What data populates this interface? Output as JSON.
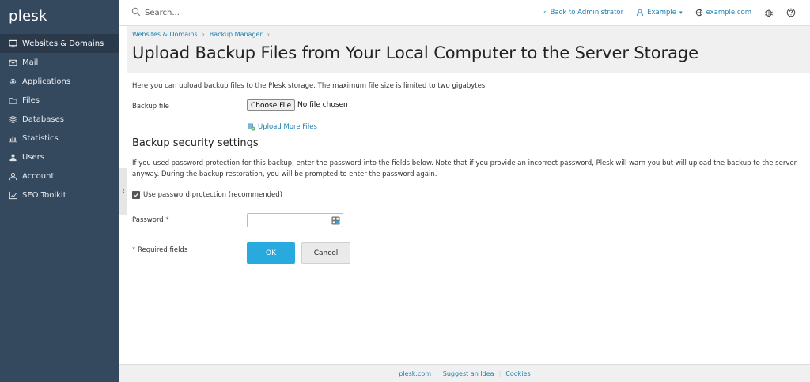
{
  "app": {
    "logo": "plesk"
  },
  "sidebar": {
    "items": [
      {
        "label": "Websites & Domains",
        "icon": "monitor-icon",
        "active": true
      },
      {
        "label": "Mail",
        "icon": "mail-icon"
      },
      {
        "label": "Applications",
        "icon": "gear-icon"
      },
      {
        "label": "Files",
        "icon": "folder-icon"
      },
      {
        "label": "Databases",
        "icon": "database-icon"
      },
      {
        "label": "Statistics",
        "icon": "bar-chart-icon"
      },
      {
        "label": "Users",
        "icon": "user-icon"
      },
      {
        "label": "Account",
        "icon": "account-icon"
      },
      {
        "label": "SEO Toolkit",
        "icon": "seo-chart-icon"
      }
    ],
    "collapse_glyph": "‹"
  },
  "header": {
    "search_placeholder": "Search...",
    "back_link": "Back to Administrator",
    "user": "Example",
    "domain": "example.com"
  },
  "breadcrumb": [
    "Websites & Domains",
    "Backup Manager"
  ],
  "page": {
    "title": "Upload Backup Files from Your Local Computer to the Server Storage",
    "intro": "Here you can upload backup files to the Plesk storage. The maximum file size is limited to two gigabytes.",
    "backup_file_label": "Backup file",
    "choose_file": "Choose File",
    "no_file": "No file chosen",
    "upload_more": "Upload More Files",
    "security_title": "Backup security settings",
    "security_desc": "If you used password protection for this backup, enter the password into the fields below. Note that if you provide an incorrect password, Plesk will warn you but will upload the backup to the server anyway. During the backup restoration, you will be prompted to enter the password again.",
    "use_password": "Use password protection (recommended)",
    "password_label": "Password",
    "required_mark": "*",
    "required_fields": "Required fields",
    "ok": "OK",
    "cancel": "Cancel"
  },
  "footer": {
    "links": [
      "plesk.com",
      "Suggest an Idea",
      "Cookies"
    ]
  },
  "colors": {
    "sidebar": "#35495e",
    "accent": "#28aade",
    "link": "#1c7fb0",
    "required": "#d9363e"
  }
}
